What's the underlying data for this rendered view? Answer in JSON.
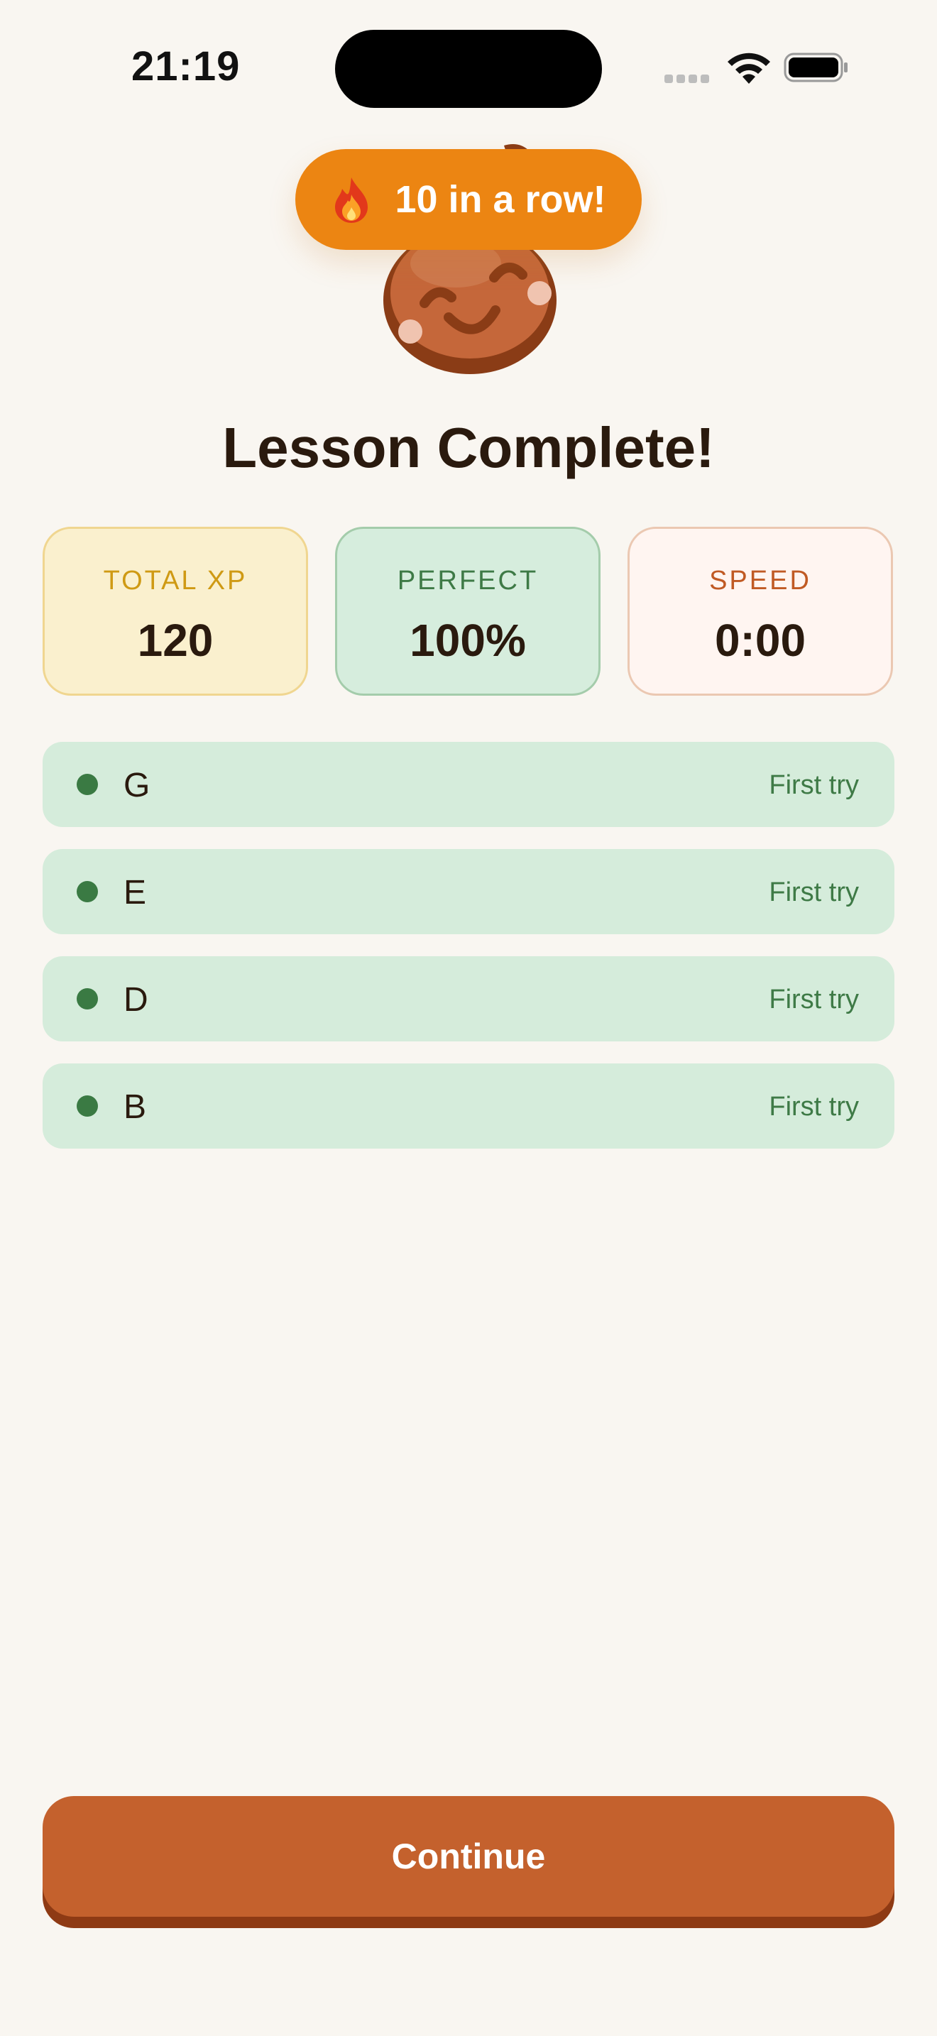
{
  "status_bar": {
    "time": "21:19"
  },
  "streak": {
    "text": "10 in a row!",
    "icon": "flame-icon"
  },
  "title": "Lesson Complete!",
  "stats": [
    {
      "label": "TOTAL XP",
      "value": "120",
      "color": "#CF9A14"
    },
    {
      "label": "PERFECT",
      "value": "100%",
      "color": "#3E7A46"
    },
    {
      "label": "SPEED",
      "value": "0:00",
      "color": "#C05A24"
    }
  ],
  "results": [
    {
      "note": "G",
      "status": "First try"
    },
    {
      "note": "E",
      "status": "First try"
    },
    {
      "note": "D",
      "status": "First try"
    },
    {
      "note": "B",
      "status": "First try"
    }
  ],
  "continue_label": "Continue",
  "colors": {
    "accent": "#C4612D",
    "streak": "#EC8512",
    "success": "#3A7A43",
    "background": "#F9F6F1"
  }
}
